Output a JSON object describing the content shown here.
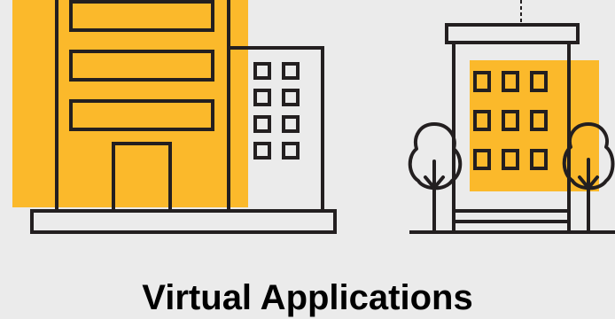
{
  "caption": {
    "text": "Virtual Applications"
  },
  "colors": {
    "background": "#ebebeb",
    "accent": "#fbb92b",
    "stroke": "#231f20",
    "text": "#000000"
  },
  "icons": {
    "left": "office-building-icon",
    "right": "apartment-building-with-trees-icon"
  }
}
